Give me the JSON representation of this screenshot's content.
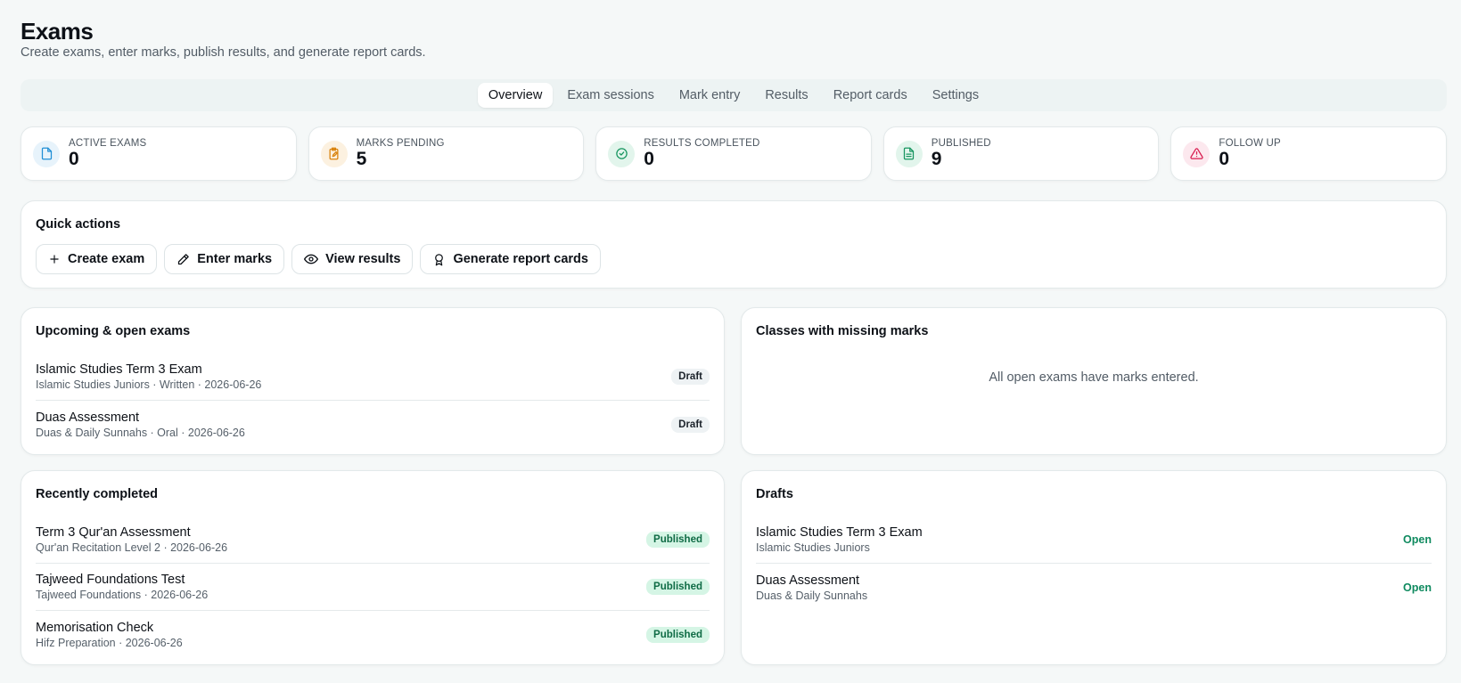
{
  "header": {
    "title": "Exams",
    "subtitle": "Create exams, enter marks, publish results, and generate report cards."
  },
  "tabs": [
    {
      "label": "Overview",
      "active": true
    },
    {
      "label": "Exam sessions"
    },
    {
      "label": "Mark entry"
    },
    {
      "label": "Results"
    },
    {
      "label": "Report cards"
    },
    {
      "label": "Settings"
    }
  ],
  "stats": [
    {
      "label": "ACTIVE EXAMS",
      "value": "0",
      "icon": "file-icon",
      "color": "#1f8fd6",
      "bg": "#e7f3fb"
    },
    {
      "label": "MARKS PENDING",
      "value": "5",
      "icon": "clipboard-edit-icon",
      "color": "#d9820c",
      "bg": "#fcf1e0"
    },
    {
      "label": "RESULTS COMPLETED",
      "value": "0",
      "icon": "check-circle-icon",
      "color": "#16955f",
      "bg": "#e2f5ec"
    },
    {
      "label": "PUBLISHED",
      "value": "9",
      "icon": "document-icon",
      "color": "#16955f",
      "bg": "#e2f5ec"
    },
    {
      "label": "FOLLOW UP",
      "value": "0",
      "icon": "alert-triangle-icon",
      "color": "#d81b4e",
      "bg": "#fce8ee"
    }
  ],
  "quick_actions": {
    "title": "Quick actions",
    "buttons": [
      {
        "label": "Create exam",
        "icon": "plus-icon"
      },
      {
        "label": "Enter marks",
        "icon": "pencil-icon"
      },
      {
        "label": "View results",
        "icon": "eye-icon"
      },
      {
        "label": "Generate report cards",
        "icon": "award-icon"
      }
    ]
  },
  "upcoming": {
    "title": "Upcoming & open exams",
    "items": [
      {
        "title": "Islamic Studies Term 3 Exam",
        "sub": "Islamic Studies Juniors · Written · 2026-06-26",
        "badge": "Draft"
      },
      {
        "title": "Duas Assessment",
        "sub": "Duas & Daily Sunnahs · Oral · 2026-06-26",
        "badge": "Draft"
      }
    ]
  },
  "missing": {
    "title": "Classes with missing marks",
    "empty": "All open exams have marks entered."
  },
  "completed": {
    "title": "Recently completed",
    "items": [
      {
        "title": "Term 3 Qur'an Assessment",
        "sub": "Qur'an Recitation Level 2 · 2026-06-26",
        "badge": "Published"
      },
      {
        "title": "Tajweed Foundations Test",
        "sub": "Tajweed Foundations · 2026-06-26",
        "badge": "Published"
      },
      {
        "title": "Memorisation Check",
        "sub": "Hifz Preparation · 2026-06-26",
        "badge": "Published"
      }
    ]
  },
  "drafts": {
    "title": "Drafts",
    "items": [
      {
        "title": "Islamic Studies Term 3 Exam",
        "sub": "Islamic Studies Juniors",
        "action": "Open"
      },
      {
        "title": "Duas Assessment",
        "sub": "Duas & Daily Sunnahs",
        "action": "Open"
      }
    ]
  }
}
